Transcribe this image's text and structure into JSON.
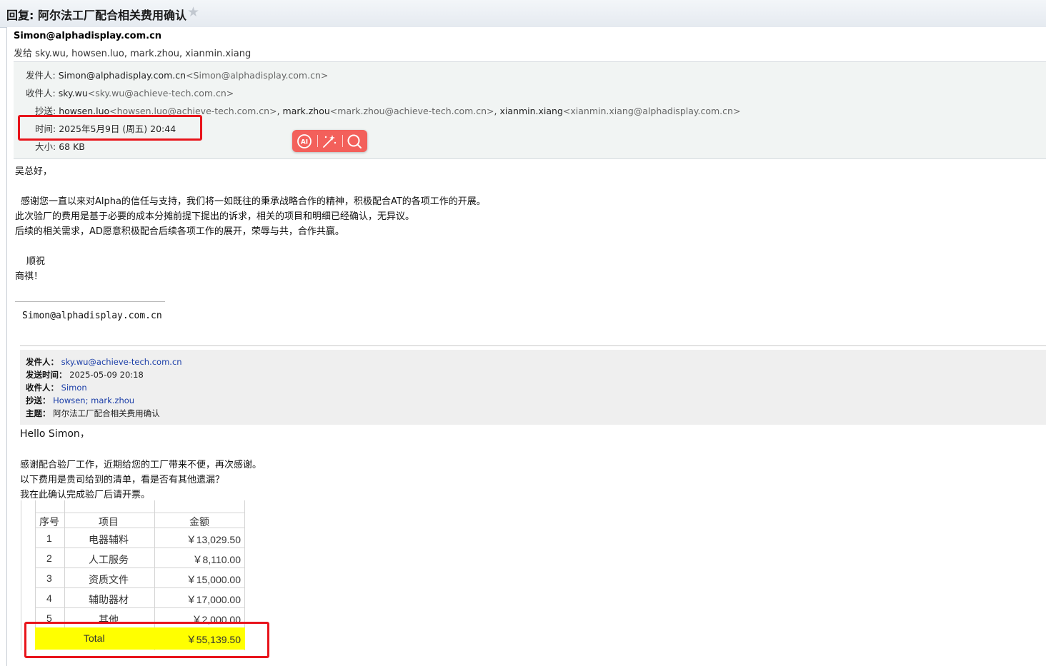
{
  "window": {
    "subject": "回复: 阿尔法工厂配合相关费用确认",
    "star": "★"
  },
  "header": {
    "sender": "Simon@alphadisplay.com.cn",
    "to_summary": "发给 sky.wu, howsen.luo, mark.zhou, xianmin.xiang"
  },
  "meta": {
    "from_label": "发件人:",
    "from_name": "Simon@alphadisplay.com.cn",
    "from_addr": "<Simon@alphadisplay.com.cn>",
    "to_label": "收件人:",
    "to_name": "sky.wu",
    "to_addr": "<sky.wu@achieve-tech.com.cn>",
    "cc_label": "抄送:",
    "cc_1_name": "howsen.luo",
    "cc_1_addr": "<howsen.luo@achieve-tech.com.cn>",
    "cc_2_name": "mark.zhou",
    "cc_2_addr": "<mark.zhou@achieve-tech.com.cn>",
    "cc_3_name": "xianmin.xiang",
    "cc_3_addr": "<xianmin.xiang@alphadisplay.com.cn>",
    "cc_sep": ",",
    "time_label": "时间:",
    "time_value": "2025年5月9日 (周五) 20:44",
    "size_label": "大小:",
    "size_value": "68 KB"
  },
  "ai_toolbar": {
    "ai_icon": "ai-assistant-icon",
    "ai_label": "AI"
  },
  "reply": {
    "greeting": "吴总好，",
    "para1": "感谢您一直以来对Alpha的信任与支持，我们将一如既往的秉承战略合作的精神，积极配合AT的各项工作的开展。",
    "para2": "此次验厂的费用是基于必要的成本分摊前提下提出的诉求，相关的项目和明细已经确认，无异议。",
    "para3": "后续的相关需求，AD愿意积极配合后续各项工作的展开，荣辱与共，合作共赢。",
    "closing1": "顺祝",
    "closing2": "商祺！",
    "signature": "Simon@alphadisplay.com.cn"
  },
  "quoted": {
    "from_label": "发件人：",
    "from_value": "sky.wu@achieve-tech.com.cn",
    "sent_label": "发送时间：",
    "sent_value": "2025-05-09 20:18",
    "to_label": "收件人：",
    "to_value": "Simon",
    "cc_label": "抄送：",
    "cc_value": "Howsen; mark.zhou",
    "subject_label": "主题：",
    "subject_value": "阿尔法工厂配合相关费用确认",
    "hello": "Hello Simon，",
    "line1": "感谢配合验厂工作，近期给您的工厂带来不便，再次感谢。",
    "line2": "以下费用是贵司给到的清单，看是否有其他遗漏？",
    "line3": "我在此确认完成验厂后请开票。"
  },
  "table": {
    "headers": [
      "序号",
      "项目",
      "金额"
    ],
    "rows": [
      [
        "1",
        "电器辅料",
        "￥13,029.50"
      ],
      [
        "2",
        "人工服务",
        "￥8,110.00"
      ],
      [
        "3",
        "资质文件",
        "￥15,000.00"
      ],
      [
        "4",
        "辅助器材",
        "￥17,000.00"
      ],
      [
        "5",
        "其他",
        "￥2,000.00"
      ]
    ],
    "total_label": "Total",
    "total_value": "￥55,139.50",
    "highlight_color": "#ffff00"
  },
  "colors": {
    "annotation_red": "#e8141b",
    "ai_toolbar": "#f3605b",
    "link_blue": "#1b3ea8"
  }
}
